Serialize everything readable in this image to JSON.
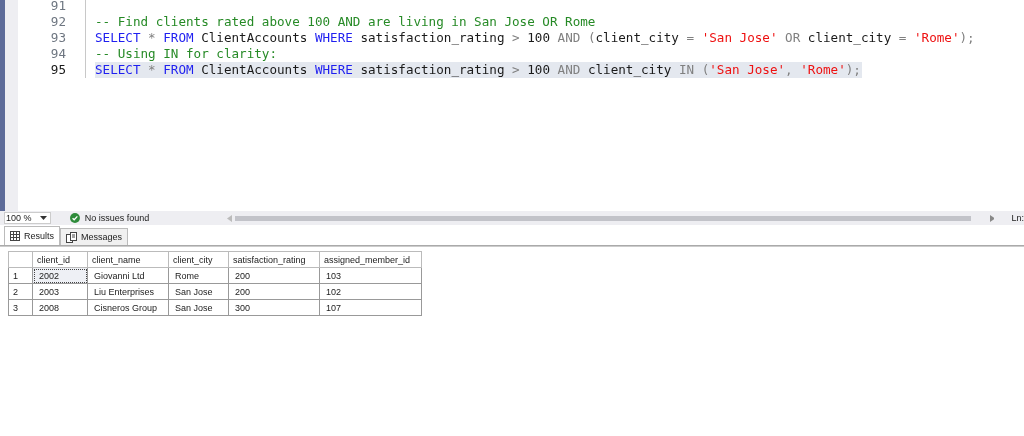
{
  "editor": {
    "lines": [
      {
        "number": "91",
        "current": false
      },
      {
        "number": "92",
        "current": false,
        "tokens": [
          {
            "kind": "comment",
            "text": "-- Find clients rated above 100 AND are living in San Jose OR Rome"
          }
        ]
      },
      {
        "number": "93",
        "current": false,
        "tokens": [
          {
            "kind": "keyword",
            "text": "SELECT"
          },
          {
            "kind": "operator",
            "text": " * "
          },
          {
            "kind": "keyword",
            "text": "FROM"
          },
          {
            "kind": "plain",
            "text": " ClientAccounts "
          },
          {
            "kind": "keyword",
            "text": "WHERE"
          },
          {
            "kind": "plain",
            "text": " satisfaction_rating "
          },
          {
            "kind": "operator",
            "text": ">"
          },
          {
            "kind": "plain",
            "text": " 100 "
          },
          {
            "kind": "operator",
            "text": "AND ("
          },
          {
            "kind": "plain",
            "text": "client_city "
          },
          {
            "kind": "operator",
            "text": "="
          },
          {
            "kind": "string",
            "text": " 'San Jose'"
          },
          {
            "kind": "operator",
            "text": " OR "
          },
          {
            "kind": "plain",
            "text": "client_city "
          },
          {
            "kind": "operator",
            "text": "="
          },
          {
            "kind": "string",
            "text": " 'Rome'"
          },
          {
            "kind": "operator",
            "text": ");"
          }
        ]
      },
      {
        "number": "94",
        "current": false,
        "tokens": [
          {
            "kind": "comment",
            "text": "-- Using IN for clarity:"
          }
        ]
      },
      {
        "number": "95",
        "current": true,
        "tokens": [
          {
            "kind": "keyword",
            "text": "SELECT"
          },
          {
            "kind": "operator",
            "text": " * "
          },
          {
            "kind": "keyword",
            "text": "FROM"
          },
          {
            "kind": "plain",
            "text": " ClientAccounts "
          },
          {
            "kind": "keyword",
            "text": "WHERE"
          },
          {
            "kind": "plain",
            "text": " satisfaction_rating "
          },
          {
            "kind": "operator",
            "text": ">"
          },
          {
            "kind": "plain",
            "text": " 100 "
          },
          {
            "kind": "operator",
            "text": "AND "
          },
          {
            "kind": "plain",
            "text": "client_city "
          },
          {
            "kind": "operator",
            "text": "IN ("
          },
          {
            "kind": "string",
            "text": "'San Jose'"
          },
          {
            "kind": "operator",
            "text": ", "
          },
          {
            "kind": "string",
            "text": "'Rome'"
          },
          {
            "kind": "operator",
            "text": ");"
          }
        ]
      }
    ]
  },
  "status_bar": {
    "zoom": "100 %",
    "issues": "No issues found",
    "position_label": "Ln:"
  },
  "tabs": [
    {
      "label": "Results",
      "selected": true
    },
    {
      "label": "Messages",
      "selected": false
    }
  ],
  "table": {
    "columns": [
      "client_id",
      "client_name",
      "client_city",
      "satisfaction_rating",
      "assigned_member_id"
    ],
    "rows": [
      {
        "number": "1",
        "focused": true,
        "cells": [
          "2002",
          "Giovanni Ltd",
          "Rome",
          "200",
          "103"
        ]
      },
      {
        "number": "2",
        "focused": false,
        "cells": [
          "2003",
          "Liu Enterprises",
          "San Jose",
          "200",
          "102"
        ]
      },
      {
        "number": "3",
        "focused": false,
        "cells": [
          "2008",
          "Cisneros Group",
          "San Jose",
          "300",
          "107"
        ]
      }
    ]
  }
}
